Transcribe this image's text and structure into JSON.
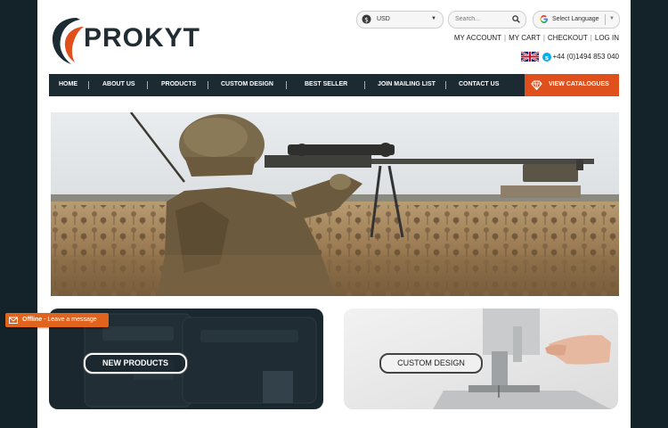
{
  "brand": {
    "name": "PROKYT"
  },
  "header": {
    "currency": {
      "value": "USD",
      "icon": "money-icon"
    },
    "search": {
      "placeholder": "Search..."
    },
    "language": {
      "label": "Select Language"
    },
    "account_links": [
      "MY ACCOUNT",
      "MY CART",
      "CHECKOUT",
      "LOG IN"
    ],
    "phone": "+44 (0)1494 853 040"
  },
  "nav": {
    "items": [
      "HOME",
      "ABOUT US",
      "PRODUCTS",
      "CUSTOM DESIGN",
      "BEST SELLER",
      "JOIN MAILING LIST",
      "CONTACT US"
    ],
    "cta": "VIEW CATALOGUES"
  },
  "promos": {
    "left": "NEW PRODUCTS",
    "right": "CUSTOM DESIGN"
  },
  "chat": {
    "status": "Offline",
    "message": "- Leave a message"
  },
  "colors": {
    "accent": "#e0501d",
    "nav_bg": "#1c2a31",
    "page_bg": "#14232a"
  }
}
